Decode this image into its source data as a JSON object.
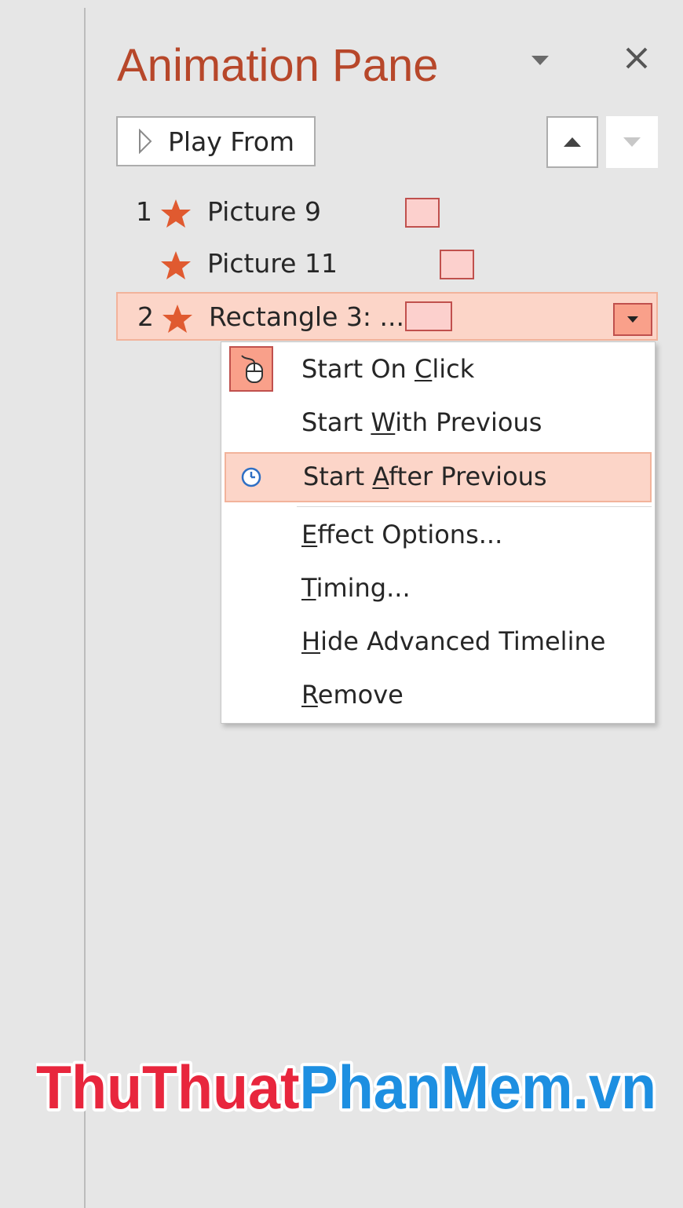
{
  "pane": {
    "title": "Animation Pane",
    "play_from_label": "Play From"
  },
  "animations": [
    {
      "number": "1",
      "name": "Picture 9",
      "selected": false
    },
    {
      "number": "",
      "name": "Picture 11",
      "selected": false
    },
    {
      "number": "2",
      "name": "Rectangle 3: ...",
      "selected": true
    }
  ],
  "context_menu": {
    "items": [
      {
        "label": "Start On Click",
        "before": "Start On ",
        "mnemonic": "C",
        "after": "lick",
        "icon": "mouse-icon"
      },
      {
        "label": "Start With Previous",
        "before": "Start ",
        "mnemonic": "W",
        "after": "ith Previous"
      },
      {
        "label": "Start After Previous",
        "before": "Start ",
        "mnemonic": "A",
        "after": "fter Previous",
        "icon": "clock-icon",
        "highlighted": true
      },
      {
        "label": "Effect Options...",
        "before": "",
        "mnemonic": "E",
        "after": "ffect Options..."
      },
      {
        "label": "Timing...",
        "before": "",
        "mnemonic": "T",
        "after": "iming..."
      },
      {
        "label": "Hide Advanced Timeline",
        "before": "",
        "mnemonic": "H",
        "after": "ide Advanced Timeline"
      },
      {
        "label": "Remove",
        "before": "",
        "mnemonic": "R",
        "after": "emove"
      }
    ]
  },
  "watermark": {
    "part1": "ThuThuat",
    "part2": "PhanMem.vn"
  },
  "colors": {
    "title": "#b7472a",
    "star": "#e05a30",
    "selection_bg": "#fcd5c8",
    "selection_border": "#f2b39b",
    "timeline_fill": "#fcd0cd",
    "timeline_border": "#c0504d",
    "watermark_red": "#e8263d",
    "watermark_blue": "#1d8fe1"
  }
}
